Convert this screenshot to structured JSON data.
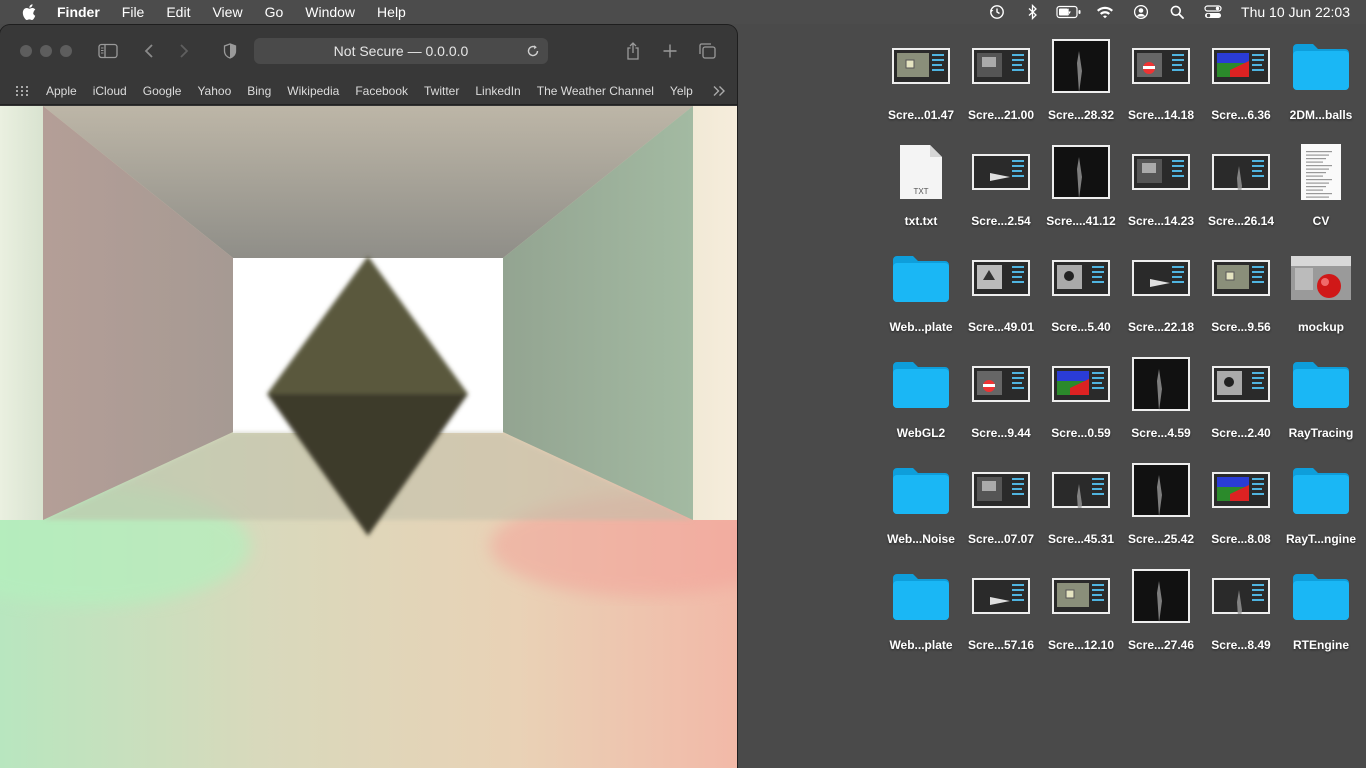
{
  "menubar": {
    "app_name": "Finder",
    "items": [
      "File",
      "Edit",
      "View",
      "Go",
      "Window",
      "Help"
    ],
    "clock": "Thu 10 Jun  22:03",
    "status_icons": [
      "time-machine-icon",
      "bluetooth-icon",
      "battery-icon",
      "wifi-icon",
      "user-icon",
      "search-icon",
      "control-center-icon"
    ]
  },
  "browser": {
    "address": "Not Secure — 0.0.0.0",
    "favorites": [
      "Apple",
      "iCloud",
      "Google",
      "Yahoo",
      "Bing",
      "Wikipedia",
      "Facebook",
      "Twitter",
      "LinkedIn",
      "The Weather Channel",
      "Yelp"
    ]
  },
  "desktop": {
    "icons": [
      {
        "label": "Scre...01.47",
        "kind": "screenshot"
      },
      {
        "label": "Scre...21.00",
        "kind": "screenshot"
      },
      {
        "label": "Scre...28.32",
        "kind": "screenshot"
      },
      {
        "label": "Scre...14.18",
        "kind": "screenshot"
      },
      {
        "label": "Scre...6.36",
        "kind": "screenshot"
      },
      {
        "label": "2DM...balls",
        "kind": "folder"
      },
      {
        "label": "txt.txt",
        "kind": "txt"
      },
      {
        "label": "Scre...2.54",
        "kind": "screenshot"
      },
      {
        "label": "Scre....41.12",
        "kind": "screenshot"
      },
      {
        "label": "Scre...14.23",
        "kind": "screenshot"
      },
      {
        "label": "Scre...26.14",
        "kind": "screenshot"
      },
      {
        "label": "CV",
        "kind": "doc"
      },
      {
        "label": "Web...plate",
        "kind": "folder"
      },
      {
        "label": "Scre...49.01",
        "kind": "screenshot"
      },
      {
        "label": "Scre...5.40",
        "kind": "screenshot"
      },
      {
        "label": "Scre...22.18",
        "kind": "screenshot"
      },
      {
        "label": "Scre...9.56",
        "kind": "screenshot"
      },
      {
        "label": "mockup",
        "kind": "image"
      },
      {
        "label": "WebGL2",
        "kind": "folder"
      },
      {
        "label": "Scre...9.44",
        "kind": "screenshot"
      },
      {
        "label": "Scre...0.59",
        "kind": "screenshot"
      },
      {
        "label": "Scre...4.59",
        "kind": "screenshot"
      },
      {
        "label": "Scre...2.40",
        "kind": "screenshot"
      },
      {
        "label": "RayTracing",
        "kind": "folder"
      },
      {
        "label": "Web...Noise",
        "kind": "folder"
      },
      {
        "label": "Scre...07.07",
        "kind": "screenshot"
      },
      {
        "label": "Scre...45.31",
        "kind": "screenshot"
      },
      {
        "label": "Scre...25.42",
        "kind": "screenshot"
      },
      {
        "label": "Scre...8.08",
        "kind": "screenshot"
      },
      {
        "label": "RayT...ngine",
        "kind": "folder"
      },
      {
        "label": "Web...plate",
        "kind": "folder"
      },
      {
        "label": "Scre...57.16",
        "kind": "screenshot"
      },
      {
        "label": "Scre...12.10",
        "kind": "screenshot"
      },
      {
        "label": "Scre...27.46",
        "kind": "screenshot"
      },
      {
        "label": "Scre...8.49",
        "kind": "screenshot"
      },
      {
        "label": "RTEngine",
        "kind": "folder"
      }
    ]
  },
  "colors": {
    "folder": "#1ab7f5",
    "menubar": "#4c4c4c",
    "desktop": "#4a4a4a"
  }
}
